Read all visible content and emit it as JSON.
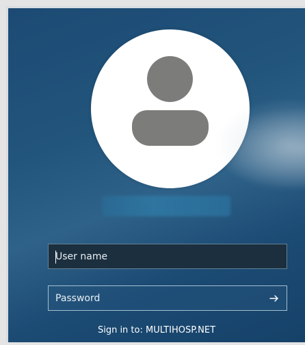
{
  "login": {
    "avatar_icon": "user-silhouette-icon",
    "username_display": "",
    "username_field": {
      "placeholder": "User name",
      "value": ""
    },
    "password_field": {
      "placeholder": "Password",
      "value": ""
    },
    "submit_icon": "arrow-right-icon",
    "sign_in_to": "Sign in to: MULTIHOSP.NET"
  },
  "colors": {
    "background": "#1c4a74",
    "avatar_bg": "#ffffff",
    "avatar_fg": "#7c7d7a",
    "field_focused_bg": "#1b2f3f",
    "text": "#ffffff"
  }
}
